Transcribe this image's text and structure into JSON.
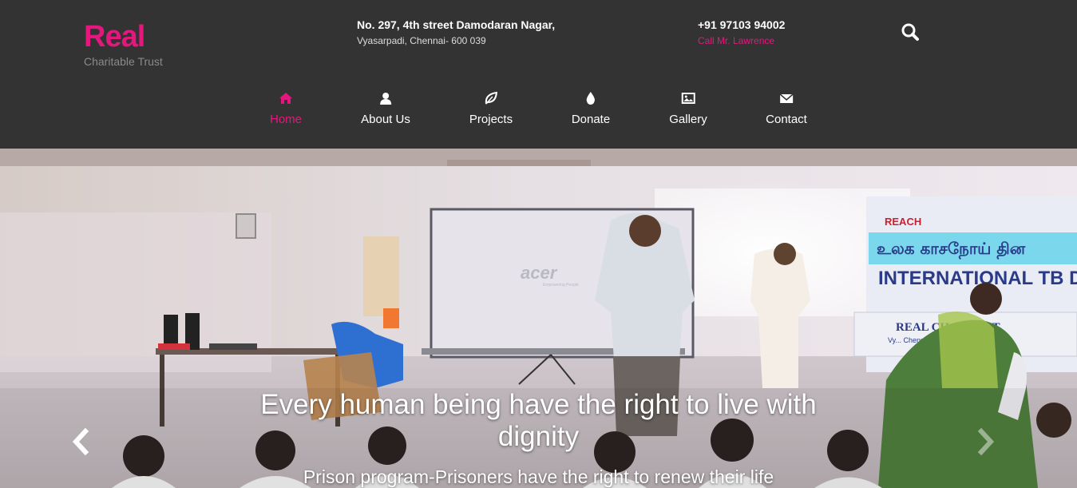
{
  "brand": {
    "title": "Real",
    "subtitle": "Charitable Trust",
    "accent_color": "#e5177e"
  },
  "contact": {
    "address_line1": "No. 297, 4th street Damodaran Nagar,",
    "address_line2": "Vyasarpadi, Chennai- 600 039",
    "phone": "+91 97103 94002",
    "phone_note": "Call Mr. Lawrence"
  },
  "search": {
    "icon": "search-icon"
  },
  "nav": {
    "items": [
      {
        "label": "Home",
        "icon": "home-icon",
        "active": true
      },
      {
        "label": "About Us",
        "icon": "user-icon",
        "active": false
      },
      {
        "label": "Projects",
        "icon": "leaf-icon",
        "active": false
      },
      {
        "label": "Donate",
        "icon": "drop-icon",
        "active": false
      },
      {
        "label": "Gallery",
        "icon": "image-icon",
        "active": false
      },
      {
        "label": "Contact",
        "icon": "envelope-icon",
        "active": false
      }
    ]
  },
  "slider": {
    "caption_title": "Every human being have the right to live with dignity",
    "caption_subtitle": "Prison program-Prisoners have the right to renew their life",
    "prev_icon": "chevron-left-icon",
    "next_icon": "chevron-right-icon",
    "photo": {
      "projector_brand": "acer",
      "projector_tagline": "Empowering People",
      "banner_top": "REACH",
      "banner_tamil": "உலக காசநோய் தின",
      "banner_heading": "INTERNATIONAL TB D",
      "banner_org": "REAL CHA     TRUST",
      "banner_place": "Vy... Chennai"
    }
  }
}
